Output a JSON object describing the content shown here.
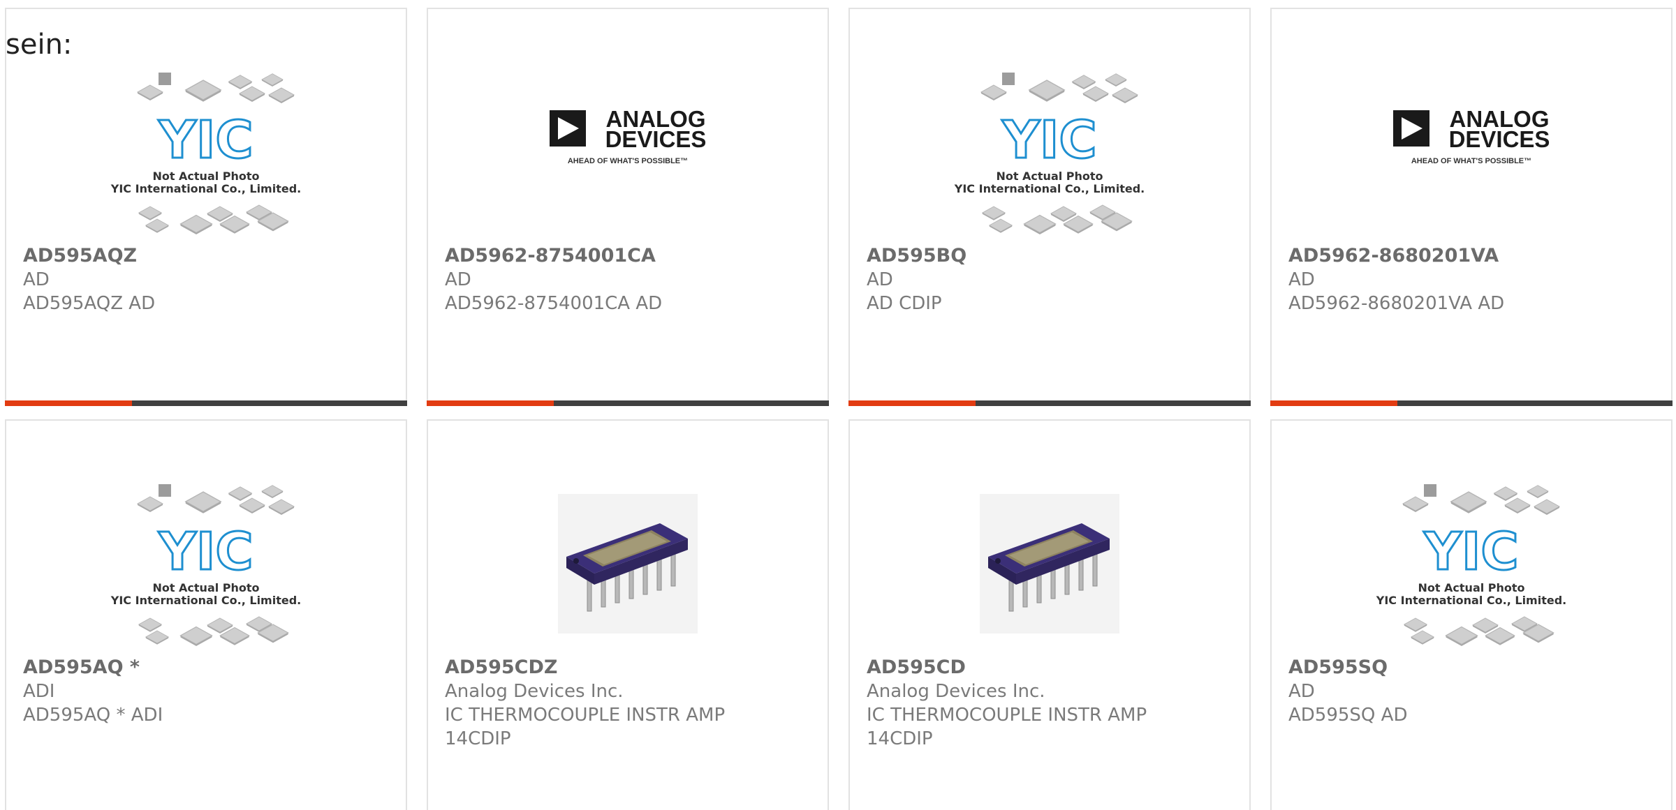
{
  "lead_text": "sein:",
  "colors": {
    "accent": "#e23c12",
    "bar": "#404040",
    "border": "#e2e2e2",
    "text": "#7a7a7a"
  },
  "placeholder_image": {
    "line1": "Not Actual Photo",
    "line2": "YIC International Co., Limited.",
    "logo": "YIC"
  },
  "adi_logo": {
    "line1": "ANALOG",
    "line2": "DEVICES",
    "tagline": "AHEAD OF WHAT'S POSSIBLE™"
  },
  "products": [
    {
      "image": "yic-placeholder",
      "part": "AD595AQZ",
      "maker": "AD",
      "desc": [
        "AD595AQZ AD"
      ]
    },
    {
      "image": "analog-devices-logo",
      "part": "AD5962-8754001CA",
      "maker": "AD",
      "desc": [
        "AD5962-8754001CA AD"
      ]
    },
    {
      "image": "yic-placeholder",
      "part": "AD595BQ",
      "maker": "AD",
      "desc": [
        "AD CDIP"
      ]
    },
    {
      "image": "analog-devices-logo",
      "part": "AD5962-8680201VA",
      "maker": "AD",
      "desc": [
        "AD5962-8680201VA AD"
      ]
    },
    {
      "image": "yic-placeholder",
      "part": "AD595AQ *",
      "maker": "ADI",
      "desc": [
        "AD595AQ * ADI"
      ]
    },
    {
      "image": "cdip-chip-photo",
      "part": "AD595CDZ",
      "maker": "Analog Devices Inc.",
      "desc": [
        "IC THERMOCOUPLE INSTR AMP",
        "14CDIP"
      ]
    },
    {
      "image": "cdip-chip-photo",
      "part": "AD595CD",
      "maker": "Analog Devices Inc.",
      "desc": [
        "IC THERMOCOUPLE INSTR AMP",
        "14CDIP"
      ]
    },
    {
      "image": "yic-placeholder",
      "part": "AD595SQ",
      "maker": "AD",
      "desc": [
        "AD595SQ AD"
      ]
    }
  ]
}
